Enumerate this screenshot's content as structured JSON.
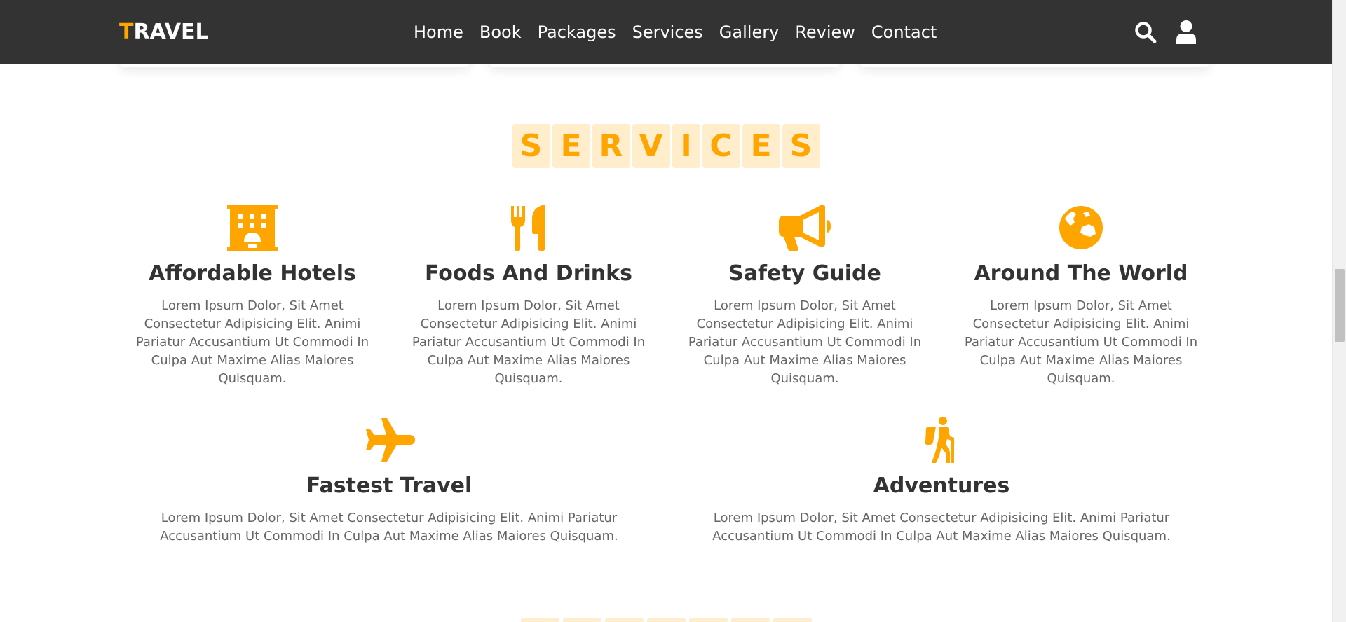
{
  "header": {
    "logo_first": "T",
    "logo_rest": "RAVEL",
    "nav": [
      {
        "label": "Home"
      },
      {
        "label": "Book"
      },
      {
        "label": "Packages"
      },
      {
        "label": "Services"
      },
      {
        "label": "Gallery"
      },
      {
        "label": "Review"
      },
      {
        "label": "Contact"
      }
    ],
    "icons": [
      "search-icon",
      "user-icon"
    ]
  },
  "services": {
    "heading_letters": [
      "S",
      "E",
      "R",
      "V",
      "I",
      "C",
      "E",
      "S"
    ],
    "items": [
      {
        "icon": "hotel-icon",
        "title": "Affordable Hotels",
        "text": "Lorem Ipsum Dolor, Sit Amet Consectetur Adipisicing Elit. Animi Pariatur Accusantium Ut Commodi In Culpa Aut Maxime Alias Maiores Quisquam."
      },
      {
        "icon": "utensils-icon",
        "title": "Foods And Drinks",
        "text": "Lorem Ipsum Dolor, Sit Amet Consectetur Adipisicing Elit. Animi Pariatur Accusantium Ut Commodi In Culpa Aut Maxime Alias Maiores Quisquam."
      },
      {
        "icon": "bullhorn-icon",
        "title": "Safety Guide",
        "text": "Lorem Ipsum Dolor, Sit Amet Consectetur Adipisicing Elit. Animi Pariatur Accusantium Ut Commodi In Culpa Aut Maxime Alias Maiores Quisquam."
      },
      {
        "icon": "globe-icon",
        "title": "Around The World",
        "text": "Lorem Ipsum Dolor, Sit Amet Consectetur Adipisicing Elit. Animi Pariatur Accusantium Ut Commodi In Culpa Aut Maxime Alias Maiores Quisquam."
      },
      {
        "icon": "plane-icon",
        "title": "Fastest Travel",
        "text": "Lorem Ipsum Dolor, Sit Amet Consectetur Adipisicing Elit. Animi Pariatur Accusantium Ut Commodi In Culpa Aut Maxime Alias Maiores Quisquam."
      },
      {
        "icon": "hiking-icon",
        "title": "Adventures",
        "text": "Lorem Ipsum Dolor, Sit Amet Consectetur Adipisicing Elit. Animi Pariatur Accusantium Ut Commodi In Culpa Aut Maxime Alias Maiores Quisquam."
      }
    ]
  },
  "colors": {
    "accent": "#ffa500",
    "header_bg": "#333333",
    "title": "#333333",
    "body_text": "#666666"
  }
}
